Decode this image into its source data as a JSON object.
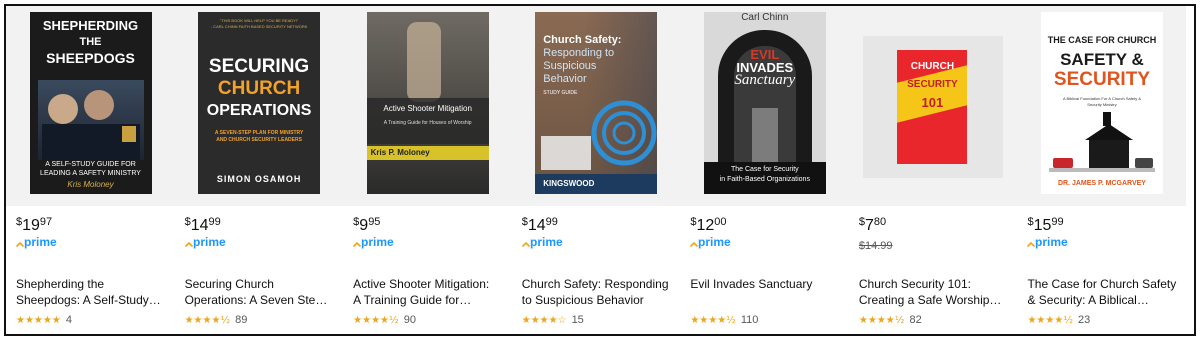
{
  "products": [
    {
      "cover": {
        "title_lines": [
          "SHEPHERDING",
          "THE",
          "SHEEPDOGS"
        ],
        "subtitle_lines": [
          "A SELF-STUDY GUIDE FOR",
          "LEADING A SAFETY MINISTRY"
        ],
        "author": "Kris Moloney"
      },
      "price": {
        "currency": "$",
        "whole": "19",
        "fraction": "97"
      },
      "list_price": "",
      "prime": "prime",
      "title_lines": [
        "Shepherding the",
        "Sheepdogs: A Self-Study…"
      ],
      "rating": 5.0,
      "stars": "★★★★★",
      "reviews": "4"
    },
    {
      "cover": {
        "tagline_lines": [
          "\"THIS BOOK WILL HELP YOU BE READY!\"",
          "- CARL CHINN FAITH BASED SECURITY NETWORK"
        ],
        "title_lines": [
          "SECURING",
          "CHURCH",
          "OPERATIONS"
        ],
        "subtitle_lines": [
          "A SEVEN-STEP PLAN FOR MINISTRY",
          "AND CHURCH SECURITY LEADERS"
        ],
        "author": "SIMON OSAMOH"
      },
      "price": {
        "currency": "$",
        "whole": "14",
        "fraction": "99"
      },
      "list_price": "",
      "prime": "prime",
      "title_lines": [
        "Securing Church",
        "Operations: A Seven Ste…"
      ],
      "rating": 4.5,
      "stars": "★★★★½",
      "reviews": "89"
    },
    {
      "cover": {
        "title": "Active Shooter Mitigation",
        "subtitle": "A Training Guide for Houses of Worship",
        "author": "Kris P. Moloney"
      },
      "price": {
        "currency": "$",
        "whole": "9",
        "fraction": "95"
      },
      "list_price": "",
      "prime": "prime",
      "title_lines": [
        "Active Shooter Mitigation:",
        "A Training Guide for…"
      ],
      "rating": 4.5,
      "stars": "★★★★½",
      "reviews": "90"
    },
    {
      "cover": {
        "title_lines": [
          "Church Safety:",
          "Responding to",
          "Suspicious",
          "Behavior"
        ],
        "label": "STUDY GUIDE",
        "brand": "KINGSWOOD"
      },
      "price": {
        "currency": "$",
        "whole": "14",
        "fraction": "99"
      },
      "list_price": "",
      "prime": "prime",
      "title_lines": [
        "Church Safety: Responding",
        "to Suspicious Behavior"
      ],
      "rating": 3.5,
      "stars": "★★★★☆",
      "reviews": "15"
    },
    {
      "cover": {
        "author": "Carl Chinn",
        "title_lines": [
          "EVIL",
          "INVADES",
          "Sanctuary"
        ],
        "subtitle_lines": [
          "The Case for Security",
          "in Faith-Based Organizations"
        ]
      },
      "price": {
        "currency": "$",
        "whole": "12",
        "fraction": "00"
      },
      "list_price": "",
      "prime": "prime",
      "title_lines": [
        "Evil Invades Sanctuary",
        ""
      ],
      "rating": 4.5,
      "stars": "★★★★½",
      "reviews": "110"
    },
    {
      "cover": {
        "title_lines": [
          "CHURCH",
          "SECURITY",
          "101"
        ]
      },
      "price": {
        "currency": "$",
        "whole": "7",
        "fraction": "80"
      },
      "list_price": "$14.99",
      "prime": "",
      "title_lines": [
        "Church Security 101:",
        "Creating a Safe Worship…"
      ],
      "rating": 4.5,
      "stars": "★★★★½",
      "reviews": "82"
    },
    {
      "cover": {
        "title_lines": [
          "THE CASE FOR CHURCH",
          "SAFETY &",
          "SECURITY"
        ],
        "subtitle_lines": [
          "A Biblical Foundation For A Church Safety &",
          "Security Ministry"
        ],
        "author": "DR. JAMES P. MCGARVEY"
      },
      "price": {
        "currency": "$",
        "whole": "15",
        "fraction": "99"
      },
      "list_price": "",
      "prime": "prime",
      "title_lines": [
        "The Case for Church Safety",
        "& Security: A Biblical…"
      ],
      "rating": 4.5,
      "stars": "★★★★½",
      "reviews": "23"
    }
  ],
  "colors": {
    "star": "#f0a41a",
    "prime": "#1a98ff",
    "text": "#0f1111",
    "muted": "#565959"
  }
}
